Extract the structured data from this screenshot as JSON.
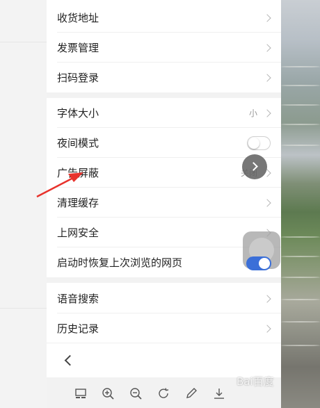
{
  "settings": {
    "group1": [
      {
        "label": "收货地址"
      },
      {
        "label": "发票管理"
      },
      {
        "label": "扫码登录"
      }
    ],
    "group2": [
      {
        "label": "字体大小",
        "value": "小"
      },
      {
        "label": "夜间模式"
      },
      {
        "label": "广告屏蔽",
        "value": "关闭"
      },
      {
        "label": "清理缓存"
      },
      {
        "label": "上网安全"
      },
      {
        "label": "启动时恢复上次浏览的网页"
      }
    ],
    "group3": [
      {
        "label": "语音搜索"
      },
      {
        "label": "历史记录"
      }
    ]
  },
  "toggles": {
    "night_mode": false,
    "restore_on_start": true
  },
  "toolbar": {
    "icons": [
      "layout-icon",
      "zoom-in-icon",
      "zoom-out-icon",
      "rotate-icon",
      "pen-icon",
      "download-icon"
    ]
  },
  "watermark": {
    "text": "Bai百度"
  },
  "colors": {
    "annotation": "#e8322c",
    "toggle_on": "#3b6fd8"
  }
}
